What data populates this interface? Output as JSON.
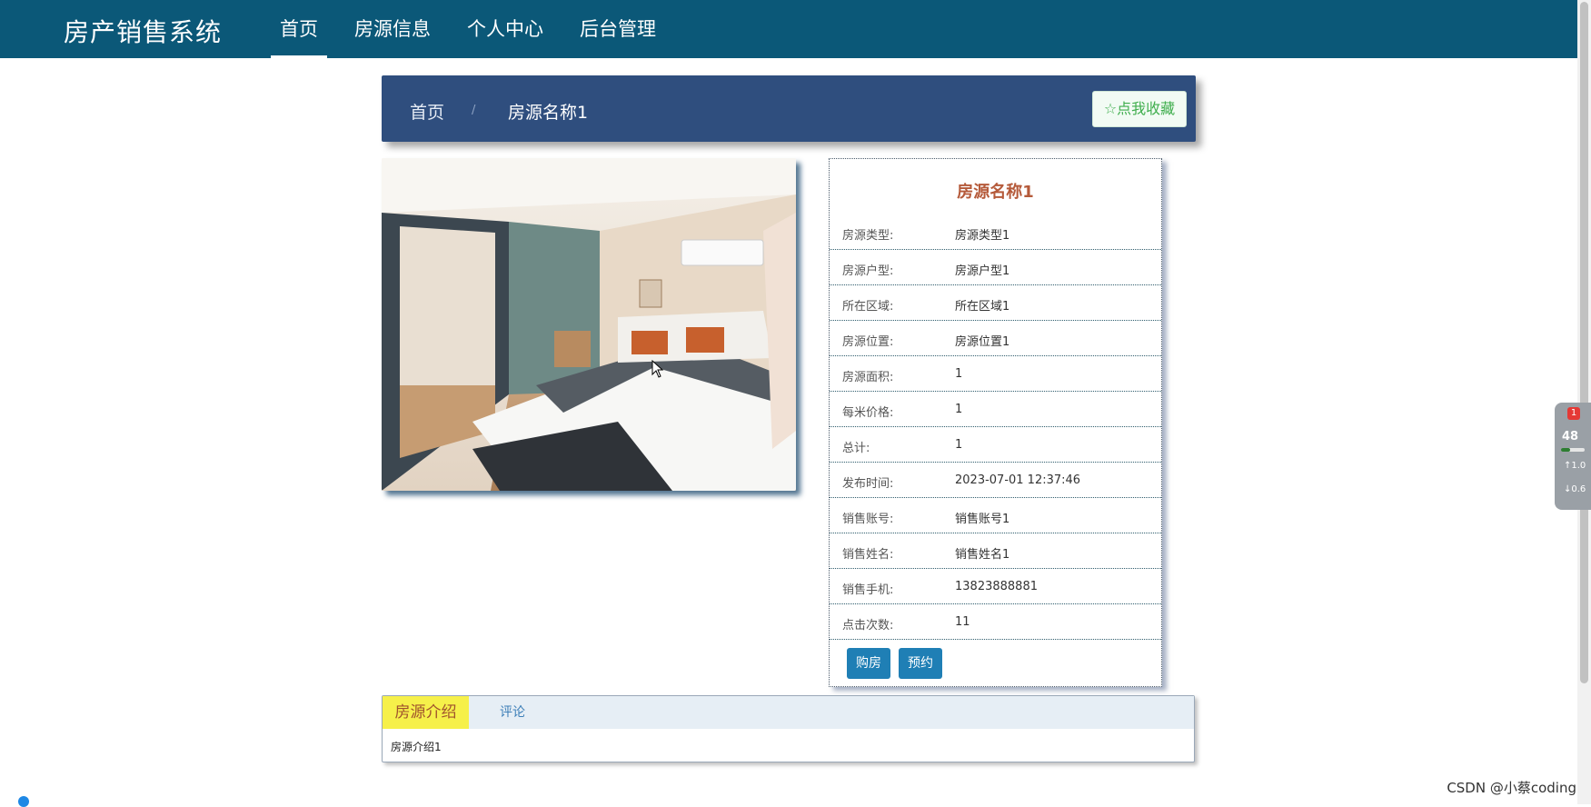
{
  "app": {
    "title": "房产销售系统"
  },
  "nav": {
    "items": [
      "首页",
      "房源信息",
      "个人中心",
      "后台管理"
    ],
    "active": "首页"
  },
  "breadcrumb": {
    "home": "首页",
    "separator": "/",
    "current": "房源名称1"
  },
  "favorite": {
    "label": "☆点我收藏"
  },
  "detail": {
    "title": "房源名称1",
    "rows": [
      {
        "label": "房源类型:",
        "value": "房源类型1"
      },
      {
        "label": "房源户型:",
        "value": "房源户型1"
      },
      {
        "label": "所在区域:",
        "value": "所在区域1"
      },
      {
        "label": "房源位置:",
        "value": "房源位置1"
      },
      {
        "label": "房源面积:",
        "value": "1"
      },
      {
        "label": "每米价格:",
        "value": "1"
      },
      {
        "label": "总计:",
        "value": "1"
      },
      {
        "label": "发布时间:",
        "value": "2023-07-01 12:37:46"
      },
      {
        "label": "销售账号:",
        "value": "销售账号1"
      },
      {
        "label": "销售姓名:",
        "value": "销售姓名1"
      },
      {
        "label": "销售手机:",
        "value": "13823888881"
      },
      {
        "label": "点击次数:",
        "value": "11"
      }
    ],
    "buttons": {
      "buy": "购房",
      "reserve": "预约"
    }
  },
  "tabs": {
    "items": [
      "房源介绍",
      "评论"
    ],
    "active": "房源介绍",
    "content": "房源介绍1"
  },
  "widget": {
    "badge": "1",
    "value": "48",
    "level": 0.4,
    "up": "1.0",
    "down": "0.6"
  },
  "watermark": "CSDN @小蔡coding",
  "colors": {
    "topbar": "#0b5878",
    "breadcrumb_bar": "#2f4e7e",
    "accent_button": "#1f7fb5",
    "active_tab": "#f6f04a"
  }
}
